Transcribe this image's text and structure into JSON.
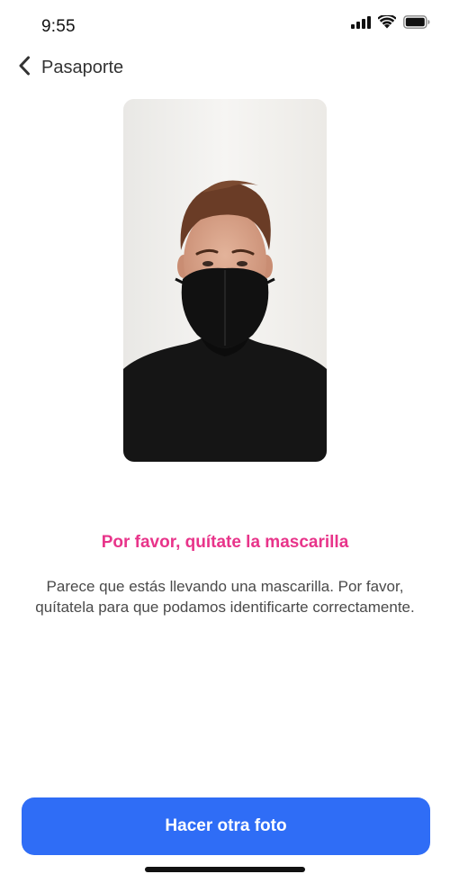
{
  "status_bar": {
    "time": "9:55",
    "icons": [
      "signal-icon",
      "wifi-icon",
      "battery-icon"
    ]
  },
  "header": {
    "back_icon": "chevron-left-icon",
    "title": "Pasaporte"
  },
  "photo": {
    "subject": "selfie-with-face-mask"
  },
  "message": {
    "title": "Por favor, quítate la mascarilla",
    "body": "Parece que estás llevando una mascarilla. Por favor, quítatela para que podamos identificarte correctamente."
  },
  "actions": {
    "retake_label": "Hacer otra foto"
  },
  "colors": {
    "accent_pink": "#e8348a",
    "primary_blue": "#2f6df6",
    "text_gray": "#4a4a4a"
  }
}
